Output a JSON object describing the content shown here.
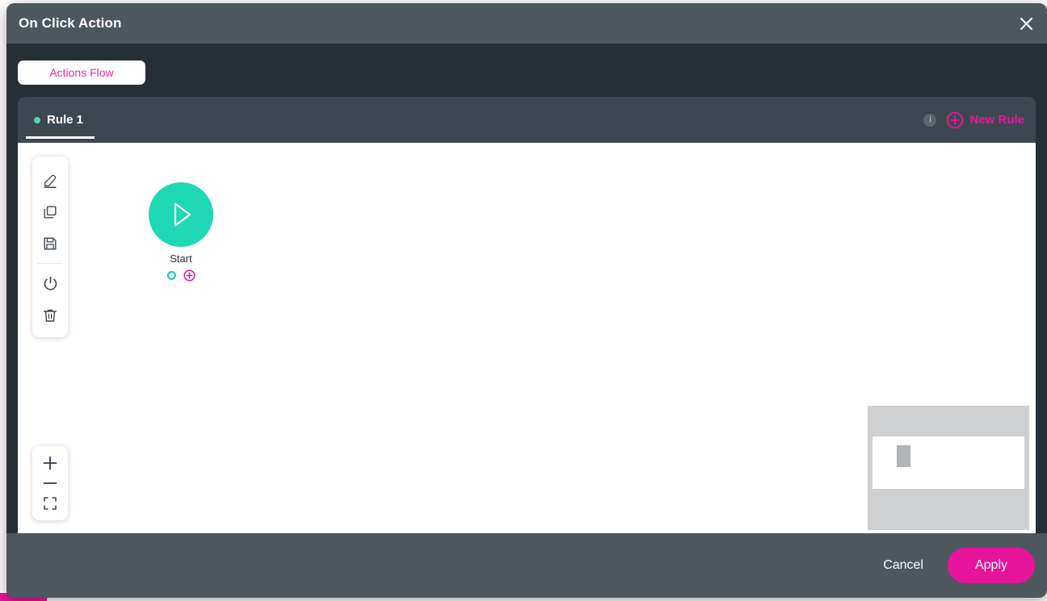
{
  "window": {
    "title": "On Click Action",
    "close_icon": "close-icon"
  },
  "flow_tabs": [
    {
      "label": "Actions Flow",
      "active": true
    }
  ],
  "rule_bar": {
    "tabs": [
      {
        "label": "Rule 1",
        "status_dot": "active",
        "active": true
      }
    ],
    "info_icon_label": "i",
    "new_rule_label": "New Rule",
    "new_rule_icon": "plus-circle-icon"
  },
  "toolbar": {
    "items": [
      {
        "name": "edit-tool",
        "icon": "pencil-icon"
      },
      {
        "name": "duplicate-tool",
        "icon": "copy-icon"
      },
      {
        "name": "save-tool",
        "icon": "save-icon"
      },
      {
        "name": "toggle-power-tool",
        "icon": "power-icon"
      },
      {
        "name": "delete-tool",
        "icon": "trash-icon"
      }
    ]
  },
  "zoom_controls": {
    "zoom_in_label": "+",
    "zoom_out_label": "–",
    "fit_icon": "fit-to-screen-icon"
  },
  "canvas": {
    "nodes": [
      {
        "id": "start",
        "label": "Start",
        "icon": "play-icon",
        "color": "#1ed8b5",
        "port_out_color": "#12cfae",
        "add_icon": "plus-circle-icon"
      }
    ],
    "minimap": {
      "name": "minimap",
      "background": "#cdcfd1",
      "viewport_color": "#ffffff",
      "node_marker_color": "#b0b5b8"
    }
  },
  "footer": {
    "cancel_label": "Cancel",
    "apply_label": "Apply"
  },
  "colors": {
    "titlebar": "#4d585e",
    "body": "#252f36",
    "rulebar": "#3c4850",
    "accent_magenta": "#e6149b",
    "accent_pink_text": "#ec2a9a",
    "accent_teal": "#1ed8b5",
    "status_green": "#56d7ab",
    "canvas": "#ffffff"
  }
}
